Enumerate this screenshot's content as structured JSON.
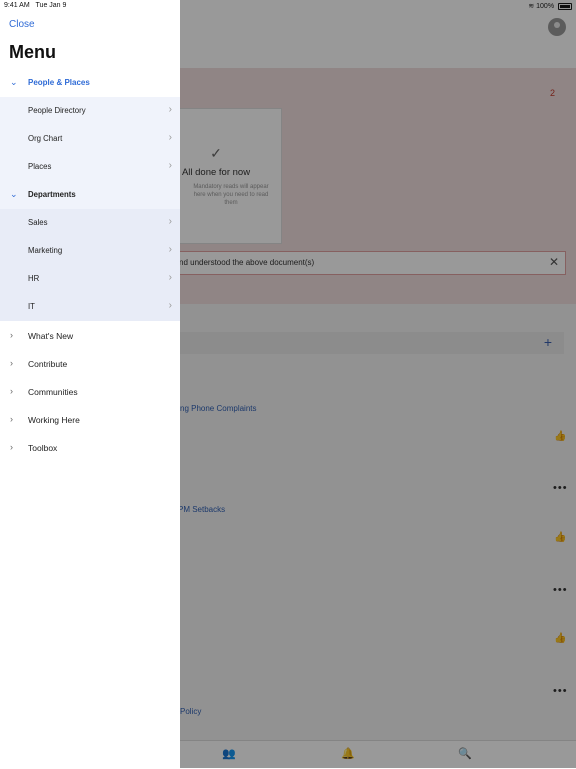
{
  "status": {
    "time": "9:41 AM",
    "date": "Tue Jan 9",
    "battery": "100%"
  },
  "menu": {
    "close": "Close",
    "title": "Menu",
    "people_places": {
      "label": "People & Places",
      "items": [
        "People Directory",
        "Org Chart",
        "Places"
      ]
    },
    "departments": {
      "label": "Departments",
      "items": [
        "Sales",
        "Marketing",
        "HR",
        "IT"
      ]
    },
    "top_items": [
      "What's New",
      "Contribute",
      "Communities",
      "Working Here",
      "Toolbox"
    ]
  },
  "background": {
    "badge": "2",
    "card_title": "All done for now",
    "card_sub": "Mandatory reads will appear here when you need to read them",
    "ack_text": "nd understood the above document(s)",
    "links": [
      "dling Phone Complaints",
      "PM Setbacks",
      "Policy"
    ]
  }
}
